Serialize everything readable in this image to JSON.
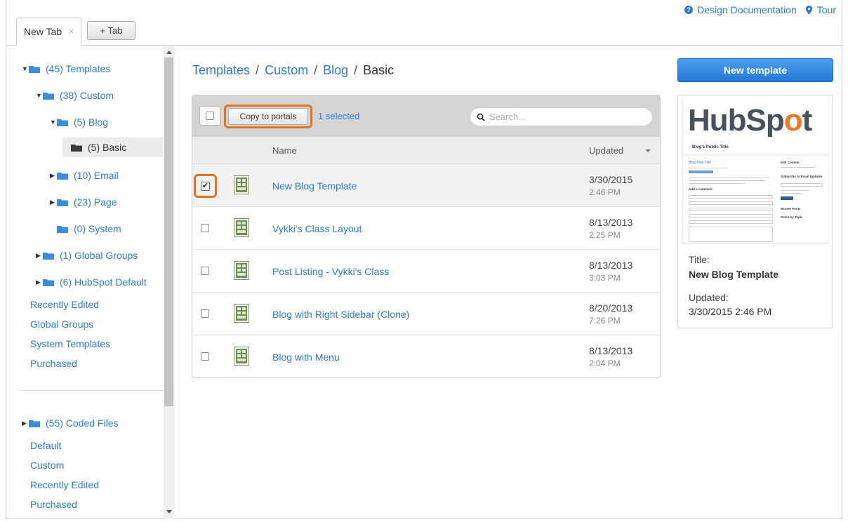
{
  "top_links": {
    "documentation": "Design Documentation",
    "tour": "Tour"
  },
  "tabs": {
    "active_tab": "New Tab",
    "close": "×",
    "add_tab": "+ Tab"
  },
  "sidebar": {
    "tree": [
      {
        "label": "(45) Templates",
        "expanded": true
      },
      {
        "label": "(38) Custom",
        "expanded": true
      },
      {
        "label": "(5) Blog",
        "expanded": true
      },
      {
        "label": "(5) Basic",
        "selected": true
      },
      {
        "label": "(10) Email",
        "expanded": false
      },
      {
        "label": "(23) Page",
        "expanded": false
      },
      {
        "label": "(0) System"
      },
      {
        "label": "(1) Global Groups",
        "expanded": false
      },
      {
        "label": "(6) HubSpot Default",
        "expanded": false
      }
    ],
    "links": [
      "Recently Edited",
      "Global Groups",
      "System Templates",
      "Purchased"
    ],
    "coded_files": {
      "label": "(55) Coded Files",
      "expanded": false
    },
    "coded_links": [
      "Default",
      "Custom",
      "Recently Edited",
      "Purchased"
    ]
  },
  "breadcrumb": {
    "items": [
      "Templates",
      "Custom",
      "Blog",
      "Basic"
    ],
    "separator": "/"
  },
  "toolbar": {
    "copy_label": "Copy to portals",
    "selected_text": "1 selected",
    "search_placeholder": "Search..."
  },
  "table": {
    "columns": {
      "name": "Name",
      "updated": "Updated"
    },
    "rows": [
      {
        "name": "New Blog Template",
        "date": "3/30/2015",
        "time": "2:46 PM",
        "checked": true
      },
      {
        "name": "Vykki's Class Layout",
        "date": "8/13/2013",
        "time": "2:25 PM",
        "checked": false
      },
      {
        "name": "Post Listing - Vykki's Class",
        "date": "8/13/2013",
        "time": "3:03 PM",
        "checked": false
      },
      {
        "name": "Blog with Right Sidebar (Clone)",
        "date": "8/20/2013",
        "time": "7:26 PM",
        "checked": false
      },
      {
        "name": "Blog with Menu",
        "date": "8/13/2013",
        "time": "2:04 PM",
        "checked": false
      }
    ]
  },
  "right_panel": {
    "new_template_label": "New template",
    "preview": {
      "logo_text": "HubSpot",
      "blog_public_title": "Blog's Public Title",
      "post_title": "Blog Post Title",
      "add_comment": "Add a comment",
      "edit_content": "Edit Content",
      "subscribe": "Subscribe to Email Updates",
      "subscribe_button": "Subscribe",
      "recent_posts": "Recent Posts",
      "posts_by_topic": "Posts by Topic"
    },
    "title_label": "Title:",
    "title_value": "New Blog Template",
    "updated_label": "Updated:",
    "updated_value": "3/30/2015 2:46 PM"
  },
  "colors": {
    "link": "#2a7bd3",
    "highlight": "#e4731f",
    "primary_button": "#2f86e0",
    "folder": "#3b8be0",
    "folder_selected": "#3a3a3a"
  }
}
